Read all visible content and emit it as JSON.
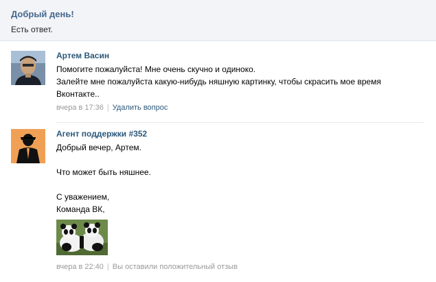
{
  "header": {
    "greeting": "Добрый день!",
    "answer_note": "Есть ответ."
  },
  "question": {
    "author": "Артем Васин",
    "text_lines": [
      "Помогите пожалуйста! Мне очень скучно и одиноко.",
      "Залейте мне пожалуйста какую-нибудь няшную картинку, чтобы скрасить мое время",
      "Вконтакте.."
    ],
    "time": "вчера в 17:36",
    "delete_link": "Удалить вопрос"
  },
  "reply": {
    "author": "Агент поддержки #352",
    "greeting_line": "Добрый вечер, Артем.",
    "body_line": "Что может быть няшнее.",
    "sign_line1": "С уважением,",
    "sign_line2": "Команда ВК,",
    "photo_icon": "panda-photo",
    "time": "вчера в 22:40",
    "status": "Вы оставили положительный отзыв"
  },
  "colors": {
    "link": "#2b587a",
    "header_bg": "#f2f4f7",
    "greeting": "#45688e",
    "meta": "#999999"
  }
}
